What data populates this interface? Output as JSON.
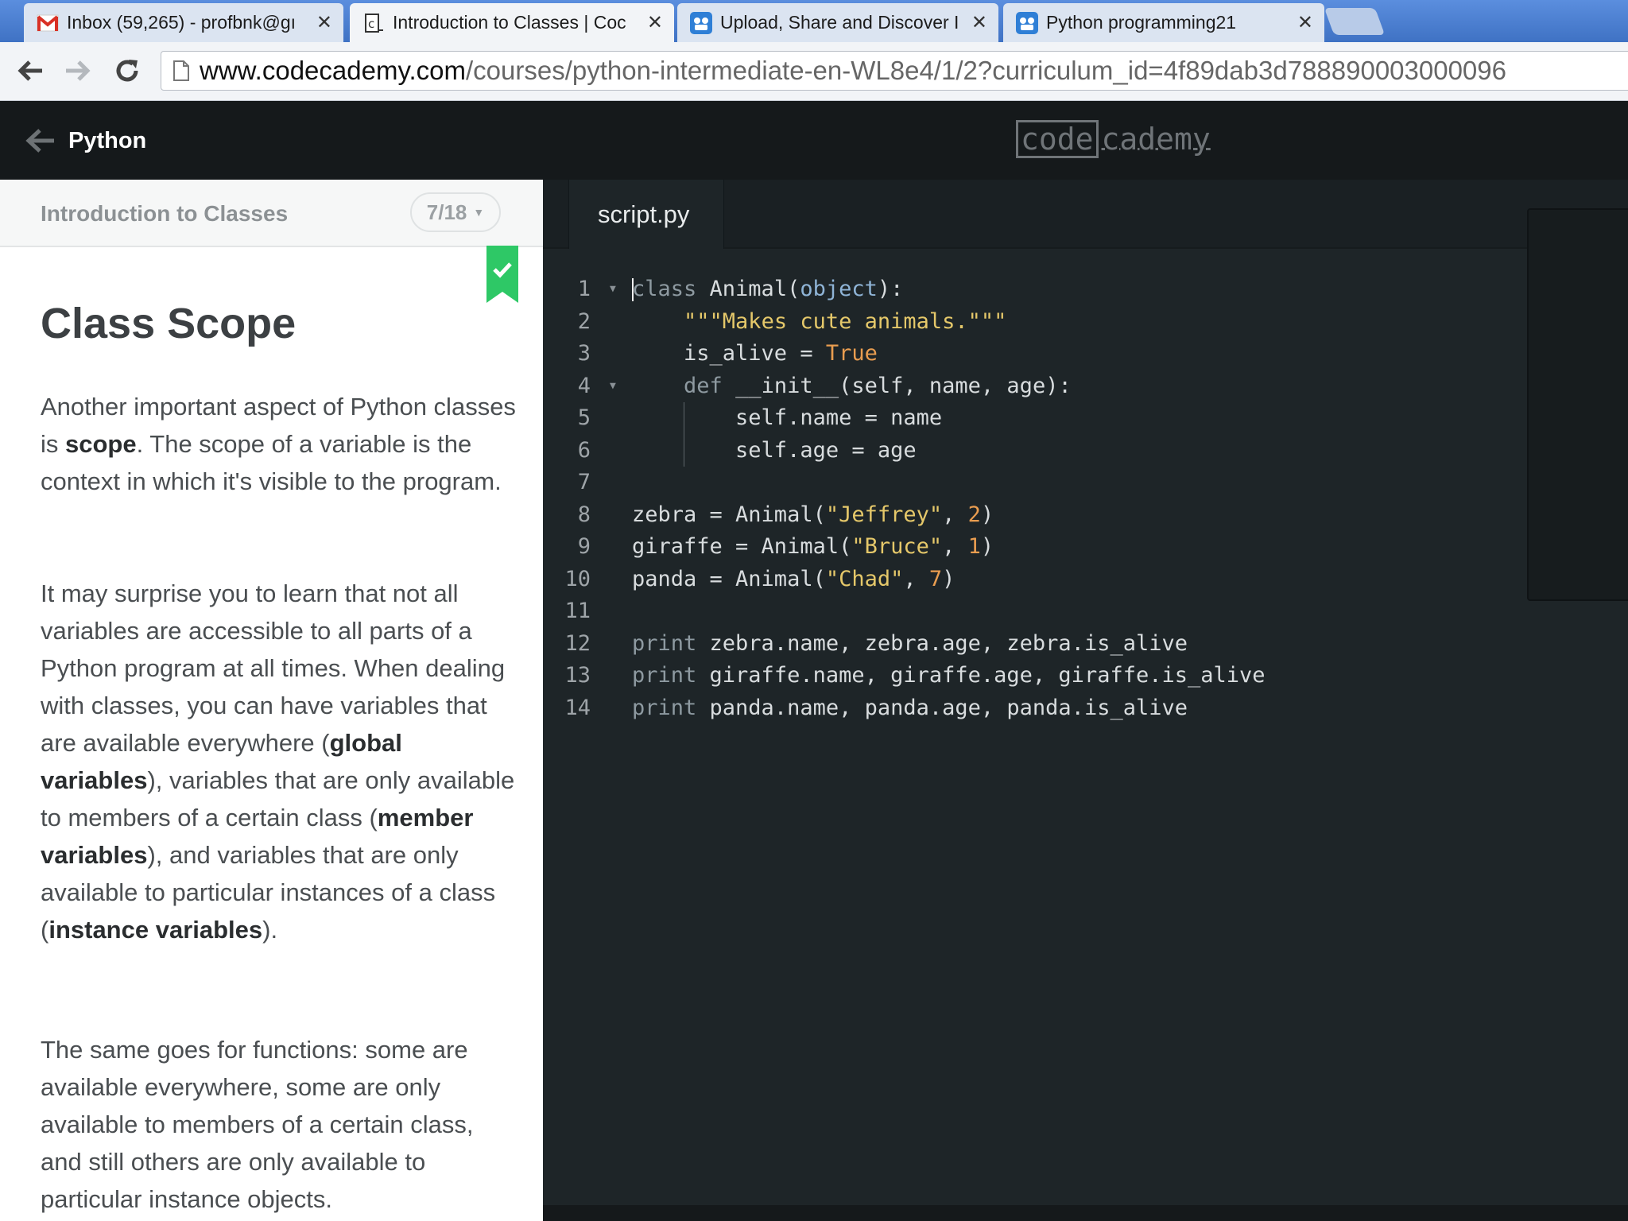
{
  "browser": {
    "tabs": [
      {
        "title": "Inbox (59,265) - profbnk@gı",
        "icon": "gmail-icon",
        "active": false
      },
      {
        "title": "Introduction to Classes | Coc",
        "icon": "codecademy-icon",
        "active": true
      },
      {
        "title": "Upload, Share and Discover I",
        "icon": "app-icon",
        "active": false
      },
      {
        "title": "Python programming21",
        "icon": "app-icon",
        "active": false
      }
    ],
    "url_domain": "www.codecademy.com",
    "url_path": "/courses/python-intermediate-en-WL8e4/1/2?curriculum_id=4f89dab3d788890003000096"
  },
  "header": {
    "course_title": "Python",
    "logo_boxed": "code",
    "logo_rest": "cademy"
  },
  "lesson": {
    "name": "Introduction to Classes",
    "progress": "7/18",
    "heading": "Class Scope",
    "p1": [
      "Another important aspect of Python classes is ",
      "scope",
      ". The scope of a variable is the context in which it's visible to the program."
    ],
    "p2": [
      "It may surprise you to learn that not all variables are accessible to all parts of a Python program at all times. When dealing with classes, you can have variables that are available everywhere (",
      "global variables",
      "), variables that are only available to members of a certain class (",
      "member variables",
      "), and variables that are only available to particular instances of a class (",
      "instance variables",
      ")."
    ],
    "p3": "The same goes for functions: some are available everywhere, some are only available to members of a certain class, and still others are only available to particular instance objects."
  },
  "editor": {
    "file_tab": "script.py",
    "line_numbers": [
      "1",
      "2",
      "3",
      "4",
      "5",
      "6",
      "7",
      "8",
      "9",
      "10",
      "11",
      "12",
      "13",
      "14"
    ],
    "lines": [
      "class Animal(object):",
      "    \"\"\"Makes cute animals.\"\"\"",
      "    is_alive = True",
      "    def __init__(self, name, age):",
      "        self.name = name",
      "        self.age = age",
      "",
      "zebra = Animal(\"Jeffrey\", 2)",
      "giraffe = Animal(\"Bruce\", 1)",
      "panda = Animal(\"Chad\", 7)",
      "",
      "print zebra.name, zebra.age, zebra.is_alive",
      "print giraffe.name, giraffe.age, giraffe.is_alive",
      "print panda.name, panda.age, panda.is_alive"
    ]
  },
  "colors": {
    "header_bg": "#15191b",
    "editor_bg": "#1e2528",
    "bookmark": "#2ec866",
    "string": "#e5c86a",
    "number": "#e99d50"
  }
}
